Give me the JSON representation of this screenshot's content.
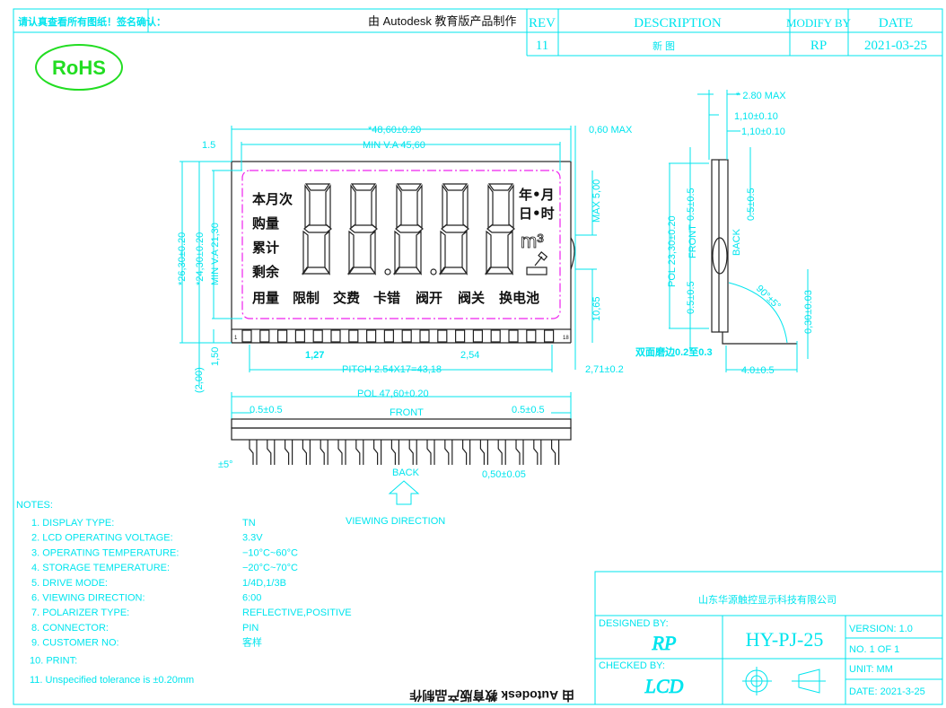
{
  "header": {
    "confirm_note": "请认真查看所有图纸！签名确认：",
    "watermark_top": "由 Autodesk 教育版产品制作",
    "rev_table": {
      "columns": [
        "REV",
        "DESCRIPTION",
        "MODIFY BY",
        "DATE"
      ],
      "rows": [
        [
          "11",
          "新 图",
          "RP",
          "2021-03-25"
        ]
      ]
    }
  },
  "rohs_logo": "RoHS",
  "colors": {
    "line": "#00e5ee",
    "rohs": "#22dd22",
    "viewing_area": "#ee22ee",
    "outline": "#222222"
  },
  "lcd": {
    "left_labels": [
      "本月次",
      "购量",
      "累计",
      "剩余"
    ],
    "bottom_labels": [
      "用量",
      "限制",
      "交费",
      "卡错",
      "阀开",
      "阀关",
      "换电池"
    ],
    "right_labels": [
      "年•月",
      "日•时",
      "m³"
    ],
    "digits": 5,
    "pin_first": "1",
    "pin_last": "18"
  },
  "dimensions": {
    "width_total": "*48,60±0.20",
    "min_va_width": "MIN V.A  45,60",
    "edge_left": "1.5",
    "max_060": "0,60  MAX",
    "max_500": "MAX  5,00",
    "d1065": "10,65",
    "d271": "2,71±0.2",
    "d127": "1,27",
    "d254": "2,54",
    "pitch": "PITCH  2.54X17=43,18",
    "height_total": "*26,30±0.20",
    "height_glass": "*24,30±0.20",
    "min_va_height": "MIN V.A  21,30",
    "d150": "1,50",
    "d200": "(2,00)",
    "pol_width": "POL  47,60±0.20",
    "front_left": "0.5±0.5",
    "front_right": "0.5±0.5",
    "front_label": "FRONT",
    "back_label": "BACK",
    "angle_pin": "±5°",
    "pin_width": "0,50±0.05",
    "viewing_direction": "VIEWING  DIRECTION",
    "side_280": "* 2.80  MAX",
    "side_110a": "1,10±0.10",
    "side_110b": "1,10±0.10",
    "side_pol": "POL  23,30±0.20",
    "side_front": "FRONT",
    "side_back": "BACK",
    "side_05a": "0.5±0.5",
    "side_05b": "0.5±0.5",
    "side_05c": "0.5±0.5",
    "side_angle": "90°±5°",
    "side_030": "0,30±0.03",
    "side_edge": "双面磨边0.2至0.3",
    "side_40": "4.0±0.5"
  },
  "notes": {
    "title": "NOTES:",
    "items": [
      {
        "label": "1.  DISPLAY  TYPE:",
        "value": "TN"
      },
      {
        "label": "2.  LCD  OPERATING  VOLTAGE:",
        "value": "3.3V"
      },
      {
        "label": "3.  OPERATING  TEMPERATURE:",
        "value": "−10°C~60°C"
      },
      {
        "label": "4.  STORAGE  TEMPERATURE:",
        "value": "−20°C~70°C"
      },
      {
        "label": "5.  DRIVE  MODE:",
        "value": "1/4D,1/3B"
      },
      {
        "label": "6.  VIEWING  DIRECTION:",
        "value": "6:00"
      },
      {
        "label": "7.  POLARIZER  TYPE:",
        "value": "REFLECTIVE,POSITIVE"
      },
      {
        "label": "8.  CONNECTOR:",
        "value": "PIN"
      },
      {
        "label": "9.  CUSTOMER  NO:",
        "value": "客样"
      },
      {
        "label": "10.  PRINT:",
        "value": ""
      },
      {
        "label": "11.  Unspecified  tolerance  is  ±0.20mm",
        "value": ""
      }
    ]
  },
  "watermark_bottom": "由 Autodesk 教育版产品制作",
  "title_block": {
    "company": "山东华源触控显示科技有限公司",
    "designed_by_label": "DESIGNED  BY:",
    "designed_by": "RP",
    "checked_by_label": "CHECKED  BY:",
    "checked_by": "LCD",
    "part_no": "HY-PJ-25",
    "version": "VERSION:    1.0",
    "sheet": "NO.  1      OF      1",
    "unit": "UNIT:        MM",
    "date": "DATE:   2021-3-25"
  }
}
